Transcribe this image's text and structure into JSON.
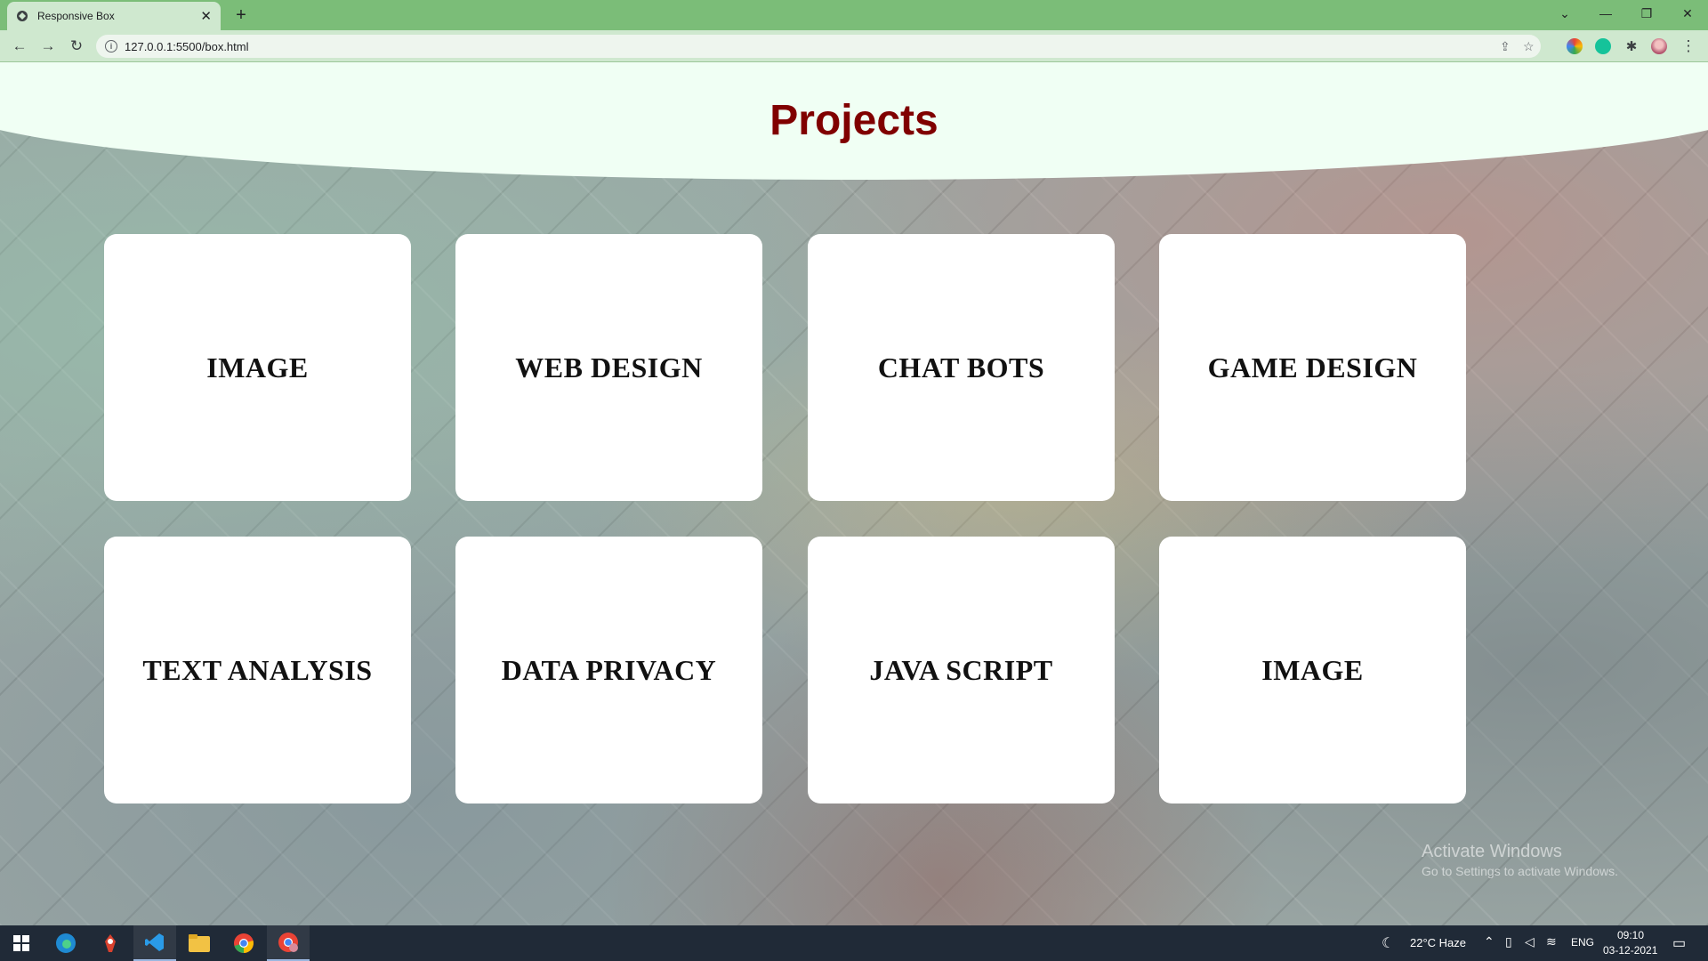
{
  "browser": {
    "tab_title": "Responsive Box",
    "tab_close": "✕",
    "new_tab": "+",
    "url": "127.0.0.1:5500/box.html",
    "window_controls": {
      "dropdown": "⌄",
      "minimize": "—",
      "restore": "❐",
      "close": "✕"
    },
    "nav": {
      "back": "←",
      "forward": "→",
      "reload": "↻"
    },
    "icons": {
      "share": "⇪",
      "star": "☆",
      "puzzle": "✱",
      "menu": "⋮"
    }
  },
  "page": {
    "title": "Projects",
    "cards": [
      {
        "label": "IMAGE"
      },
      {
        "label": "WEB DESIGN"
      },
      {
        "label": "CHAT BOTS"
      },
      {
        "label": "GAME DESIGN"
      },
      {
        "label": "TEXT ANALYSIS"
      },
      {
        "label": "DATA PRIVACY"
      },
      {
        "label": "JAVA SCRIPT"
      },
      {
        "label": "IMAGE"
      }
    ],
    "watermark": {
      "title": "Activate Windows",
      "subtitle": "Go to Settings to activate Windows."
    }
  },
  "taskbar": {
    "weather": "22°C  Haze",
    "language": "ENG",
    "time": "09:10",
    "date": "03-12-2021"
  },
  "colors": {
    "title": "#800000",
    "header_bg": "#f0fff4",
    "tabbar": "#7bbd78"
  }
}
